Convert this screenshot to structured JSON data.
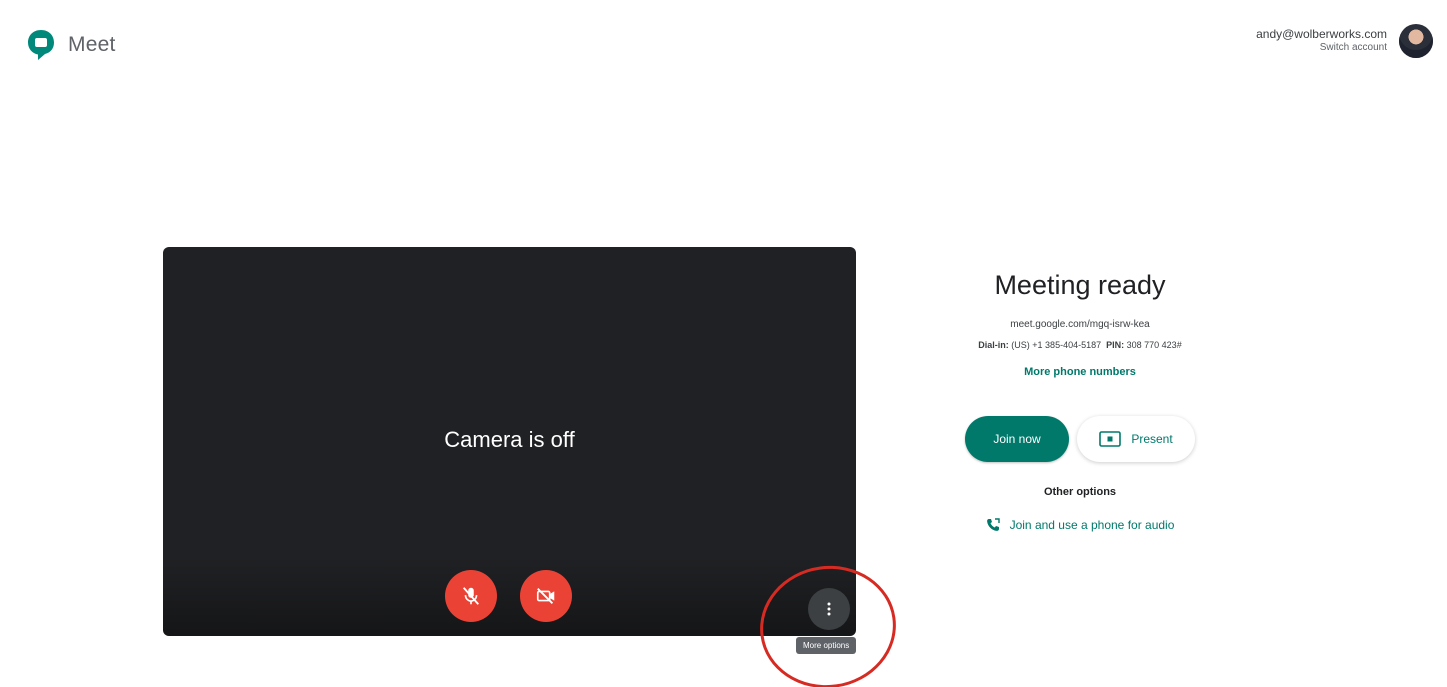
{
  "app": {
    "name": "Meet"
  },
  "account": {
    "email": "andy@wolberworks.com",
    "switch_label": "Switch account"
  },
  "preview": {
    "camera_status": "Camera is off",
    "more_options_tooltip": "More options"
  },
  "meeting": {
    "title": "Meeting ready",
    "link": "meet.google.com/mgq-isrw-kea",
    "dial_label": "Dial-in:",
    "dial_number": "(US) +1 385-404-5187",
    "pin_label": "PIN:",
    "pin_value": "308 770 423#",
    "more_numbers": "More phone numbers",
    "join_label": "Join now",
    "present_label": "Present",
    "other_options": "Other options",
    "phone_audio": "Join and use a phone for audio"
  },
  "colors": {
    "accent": "#00796b",
    "danger": "#ea4335",
    "preview_bg": "#202124",
    "annotation": "#d62b23"
  },
  "icons": {
    "logo": "meet-logo-icon",
    "mic": "mic-off-icon",
    "camera": "camera-off-icon",
    "more": "more-vert-icon",
    "present": "present-icon",
    "phone": "phone-icon"
  }
}
